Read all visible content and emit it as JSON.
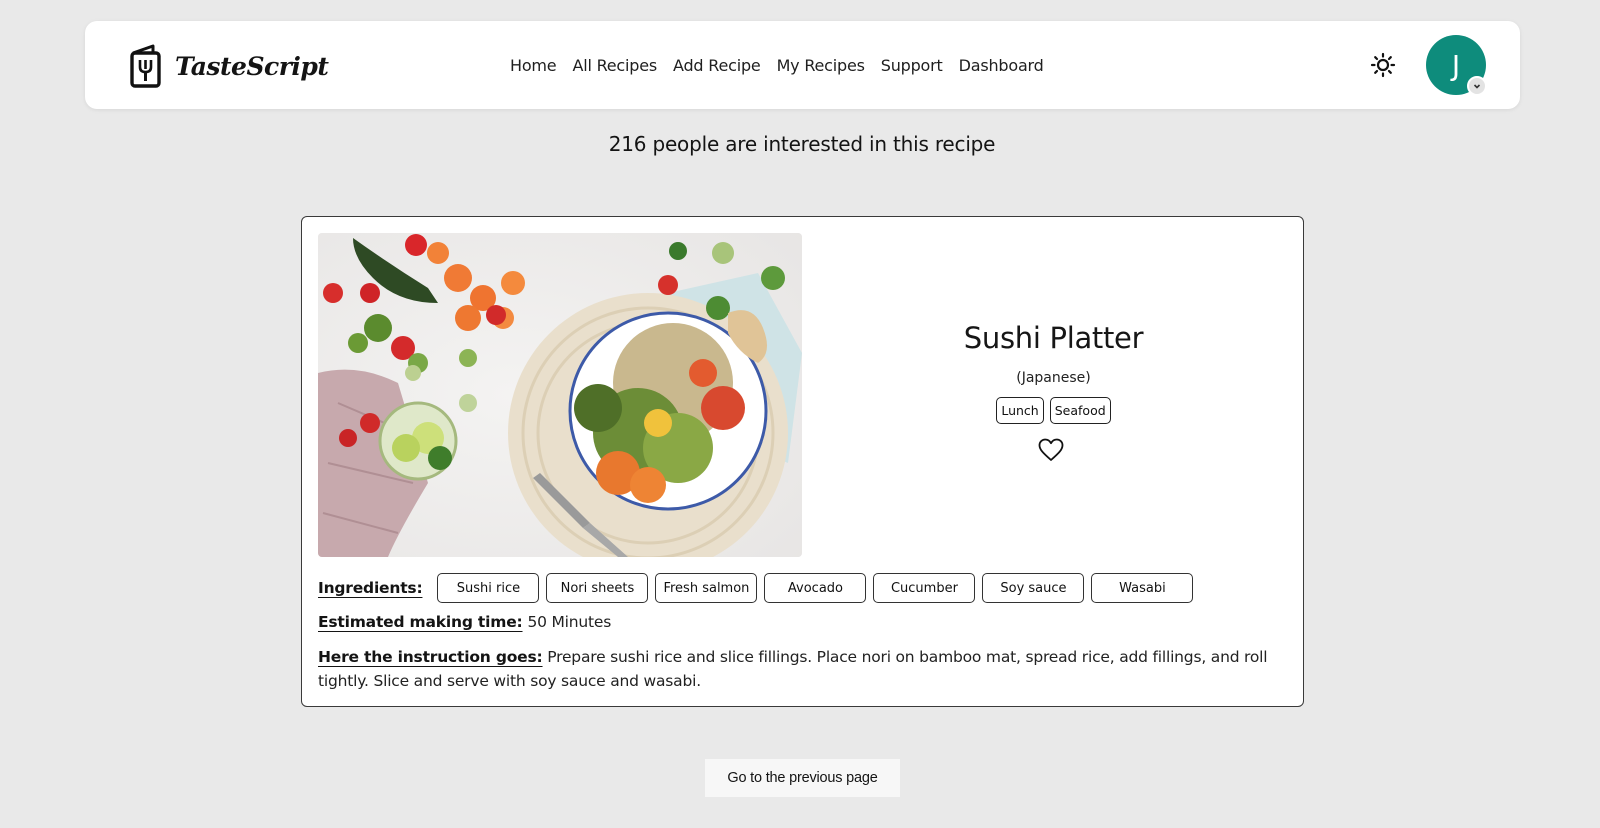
{
  "brand": {
    "name": "TasteScript",
    "icon": "fork-menu-icon"
  },
  "nav": {
    "links": [
      "Home",
      "All Recipes",
      "Add Recipe",
      "My Recipes",
      "Support",
      "Dashboard"
    ]
  },
  "header_actions": {
    "theme_icon": "sun-icon",
    "avatar_initial": "J",
    "avatar_color": "#0e8c7c",
    "avatar_menu_icon": "chevron-down-icon"
  },
  "interest_text": "216 people are interested in this recipe",
  "recipe": {
    "title": "Sushi Platter",
    "cuisine": "(Japanese)",
    "tags": [
      "Lunch",
      "Seafood"
    ],
    "favorite_icon": "heart-outline-icon",
    "ingredients_label": "Ingredients:",
    "ingredients": [
      "Sushi rice",
      "Nori sheets",
      "Fresh salmon",
      "Avocado",
      "Cucumber",
      "Soy sauce",
      "Wasabi"
    ],
    "time_label": "Estimated making time:",
    "time_value": "50 Minutes",
    "instruction_label": "Here the instruction goes:",
    "instruction_text": "Prepare sushi rice and slice fillings. Place nori on bamboo mat, spread rice, add fillings, and roll tightly. Slice and serve with soy sauce and wasabi."
  },
  "prev_button_label": "Go to the previous page"
}
